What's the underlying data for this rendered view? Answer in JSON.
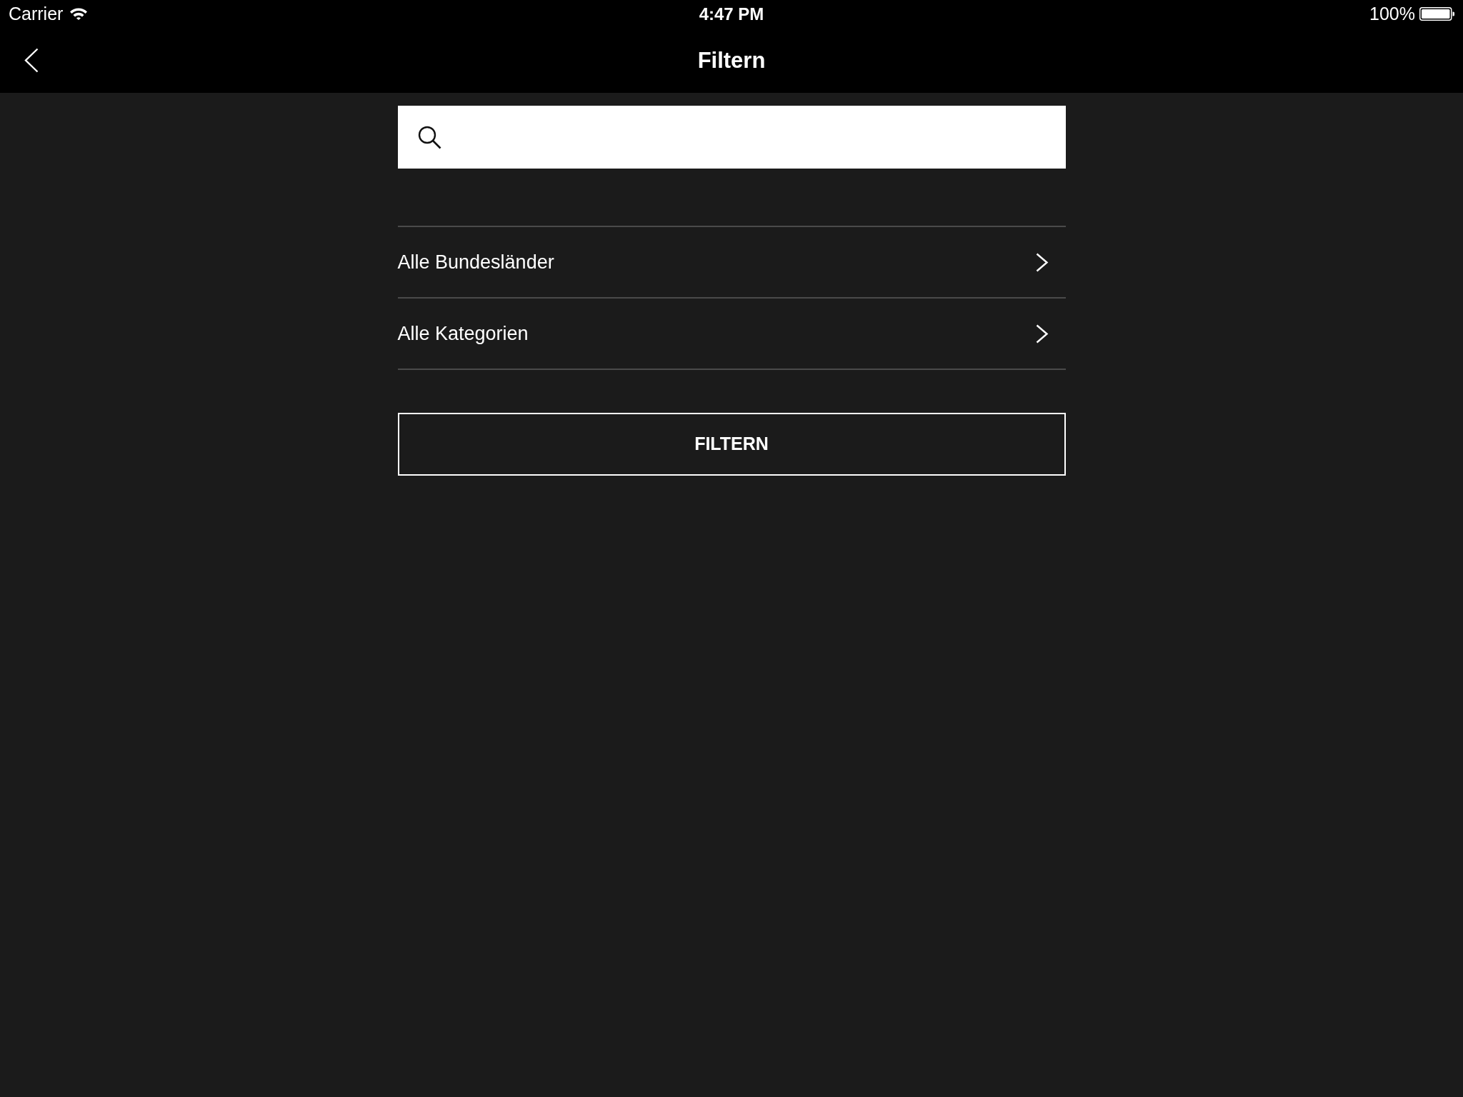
{
  "status_bar": {
    "carrier": "Carrier",
    "time": "4:47 PM",
    "battery": "100%"
  },
  "nav_bar": {
    "title": "Filtern"
  },
  "filter_rows": [
    {
      "label": "Alle Bundesländer"
    },
    {
      "label": "Alle Kategorien"
    }
  ],
  "buttons": [
    {
      "label": "FILTERN"
    }
  ]
}
